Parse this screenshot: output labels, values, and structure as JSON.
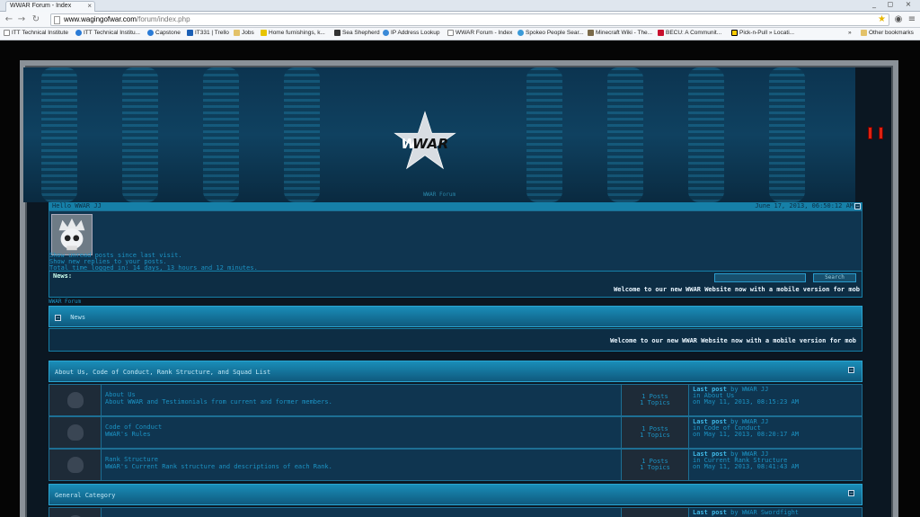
{
  "browser": {
    "tab_title": "WWAR Forum - Index",
    "tab_close": "×",
    "window_controls": [
      "_",
      "◻",
      "×"
    ],
    "url_domain": "www.wagingofwar.com",
    "url_path": "/forum/index.php",
    "bookmarks": [
      "ITT Technical Institute",
      "ITT Technical Institu...",
      "Capstone",
      "IT331 | Trello",
      "Jobs",
      "Home furnishings, k...",
      "Sea Shepherd",
      "IP Address Lookup",
      "WWAR Forum - Index",
      "Spokeo People Sear...",
      "Minecraft Wiki - The...",
      "BECU: A Communit...",
      "Pick-n-Pull » Locati..."
    ],
    "bookmarks_overflow": "»",
    "other_bookmarks": "Other bookmarks"
  },
  "banner": {
    "logo_text": "WAR",
    "logo_text_prefix": "W",
    "caption": "WWAR Forum"
  },
  "userbar": {
    "greeting": "Hello WWAR JJ",
    "datetime": "June 17, 2013, 06:50:12 AM",
    "toggle": "−"
  },
  "userinfo": {
    "line1": "Show unread posts since last visit.",
    "line2": "Show new replies to your posts.",
    "line3": "Total time logged in: 14 days, 13 hours and 12 minutes."
  },
  "newsbar": {
    "label": "News:",
    "search_value": "",
    "search_button": "Search",
    "ticker": "Welcome to our new WWAR Website now with a mobile version for mob"
  },
  "forum_label": "WWAR Forum",
  "news_section": {
    "toggle": "−",
    "title": "News",
    "ticker": "Welcome to our new WWAR Website now with a mobile version for mob"
  },
  "categories": [
    {
      "title": "About Us, Code of Conduct, Rank Structure, and Squad List",
      "toggle": "−",
      "boards": [
        {
          "name": "About Us",
          "desc": "About WWAR and Testimonials from current and former members.",
          "posts": "1 Posts",
          "topics": "1 Topics",
          "last_label": "Last post",
          "last_by": "by WWAR JJ",
          "last_in": "in About Us",
          "last_on": "on May 11, 2013, 08:15:23 AM"
        },
        {
          "name": "Code of Conduct",
          "desc": "WWAR's Rules",
          "posts": "1 Posts",
          "topics": "1 Topics",
          "last_label": "Last post",
          "last_by": "by WWAR JJ",
          "last_in": "in Code of Conduct",
          "last_on": "on May 11, 2013, 08:20:17 AM"
        },
        {
          "name": "Rank Structure",
          "desc": "WWAR's Current Rank structure and descriptions of each Rank.",
          "posts": "1 Posts",
          "topics": "1 Topics",
          "last_label": "Last post",
          "last_by": "by WWAR JJ",
          "last_in": "in Current Rank Structure",
          "last_on": "on May 11, 2013, 08:41:43 AM"
        }
      ]
    },
    {
      "title": "General Category",
      "toggle": "−",
      "boards": [
        {
          "last_label": "Last post",
          "last_by": "by WWAR Swordfight"
        }
      ]
    }
  ],
  "colors": {
    "accent": "#1c93c4",
    "header_gradient_top": "#1a8db8",
    "panel_bg": "#0f3550",
    "frame_metal": "#8a9198",
    "ticker_text": "#eaf6ff"
  }
}
